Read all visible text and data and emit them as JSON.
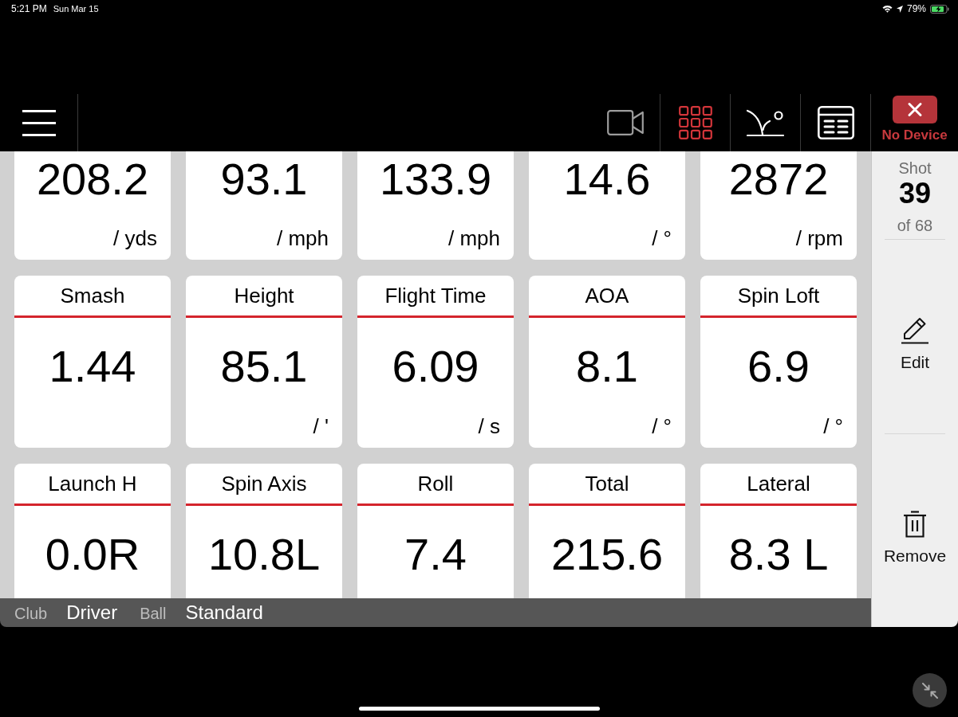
{
  "status_bar": {
    "time": "5:21 PM",
    "date": "Sun Mar 15",
    "battery": "79%"
  },
  "toolbar": {
    "view_buttons": [
      {
        "kind": "video",
        "selected": false,
        "disabled": true
      },
      {
        "kind": "grid",
        "selected": true,
        "disabled": false
      },
      {
        "kind": "trajectory",
        "selected": false,
        "disabled": false
      },
      {
        "kind": "table",
        "selected": false,
        "disabled": false
      }
    ],
    "device_button": {
      "label": "No Device"
    }
  },
  "metric_rows": [
    {
      "kind": "cut_top",
      "tiles": [
        {
          "value": "208.2",
          "unit": "/ yds"
        },
        {
          "value": "93.1",
          "unit": "/ mph"
        },
        {
          "value": "133.9",
          "unit": "/ mph"
        },
        {
          "value": "14.6",
          "unit": "/ °"
        },
        {
          "value": "2872",
          "unit": "/ rpm"
        }
      ]
    },
    {
      "kind": "full",
      "tiles": [
        {
          "label": "Smash",
          "value": "1.44"
        },
        {
          "label": "Height",
          "value": "85.1",
          "unit": "/ '"
        },
        {
          "label": "Flight Time",
          "value": "6.09",
          "unit": "/ s"
        },
        {
          "label": "AOA",
          "value": "8.1",
          "unit": "/ °"
        },
        {
          "label": "Spin Loft",
          "value": "6.9",
          "unit": "/ °"
        }
      ]
    },
    {
      "kind": "cut_bottom",
      "tiles": [
        {
          "label": "Launch H",
          "value": "0.0R"
        },
        {
          "label": "Spin Axis",
          "value": "10.8L"
        },
        {
          "label": "Roll",
          "value": "7.4"
        },
        {
          "label": "Total",
          "value": "215.6"
        },
        {
          "label": "Lateral",
          "value": "8.3 L"
        }
      ]
    }
  ],
  "info_bar": [
    {
      "label": "Club",
      "value": "Driver"
    },
    {
      "label": "Ball",
      "value": "Standard"
    }
  ],
  "shot_panel": {
    "label": "Shot",
    "number": "39",
    "total": "of 68",
    "actions": [
      {
        "kind": "edit",
        "label": "Edit"
      },
      {
        "kind": "remove",
        "label": "Remove"
      }
    ]
  }
}
